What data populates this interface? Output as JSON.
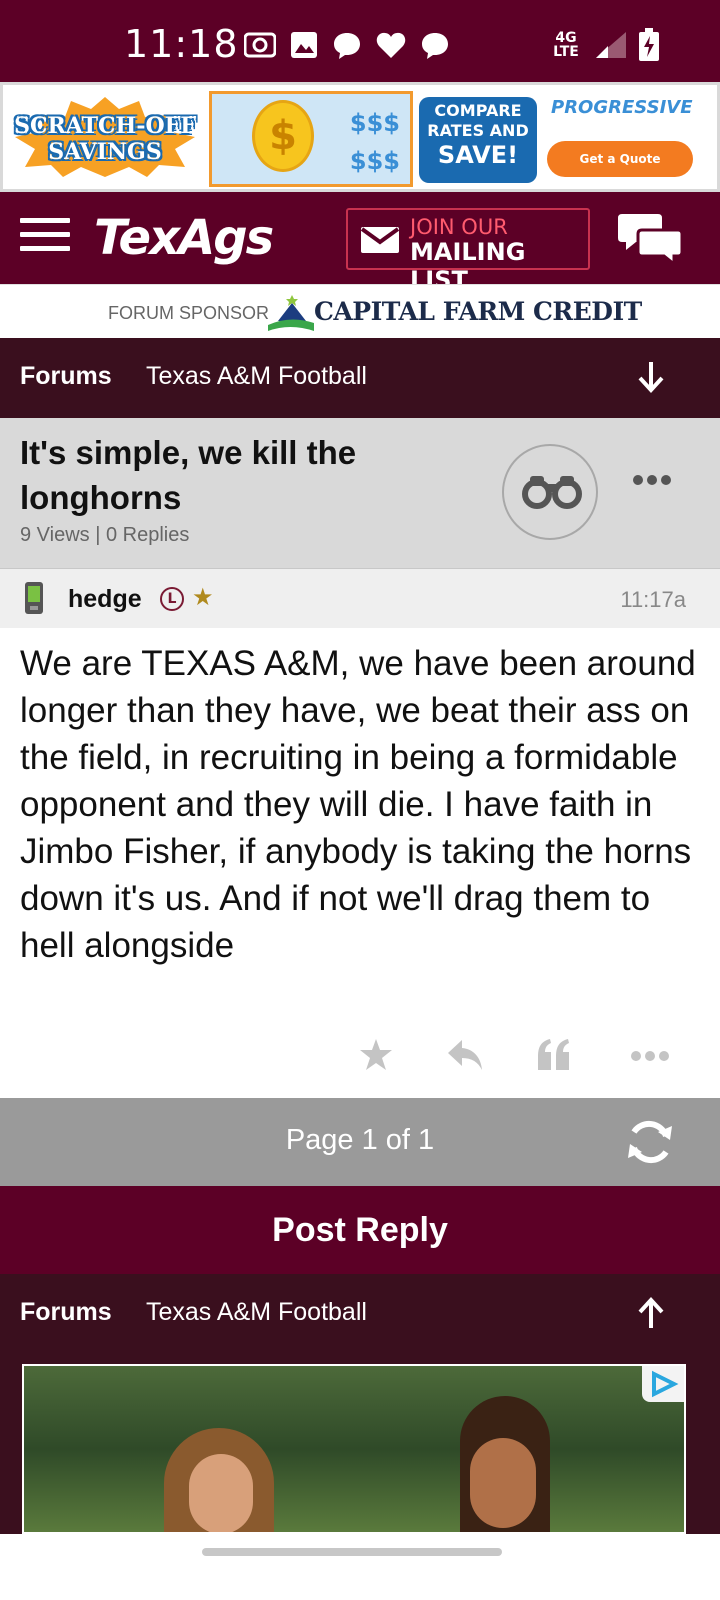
{
  "status_bar": {
    "time": "11:18",
    "network": "4G LTE"
  },
  "ads": {
    "top_banner": {
      "scratch_text": "SCRATCH-OFF SAVINGS",
      "compare_line1": "COMPARE",
      "compare_line2": "RATES AND",
      "compare_line3": "SAVE!",
      "brand": "PROGRESSIVE",
      "cta": "Get a Quote",
      "dollar_row1": "$$$",
      "dollar_row2": "$$$"
    }
  },
  "header": {
    "logo": "TexAgs",
    "mailing_join": "JOIN OUR",
    "mailing_list": "MAILING LIST"
  },
  "sponsor": {
    "label": "FORUM SPONSOR",
    "name": "CAPITAL FARM CREDIT"
  },
  "breadcrumb": {
    "forums": "Forums",
    "board": "Texas A&M Football"
  },
  "thread": {
    "title": "It's simple, we kill the longhorns",
    "stats": "9 Views | 0 Replies"
  },
  "post": {
    "user": "hedge",
    "badge": "L",
    "star": "★",
    "time": "11:17a",
    "body": "We are TEXAS A&M, we have been around longer than they have, we beat their ass on the field, in recruiting in being a formidable opponent and they will die. I have faith in Jimbo Fisher, if anybody is taking the horns down it's us. And if not we'll drag them to hell alongside"
  },
  "pager": {
    "text": "Page 1 of 1"
  },
  "actions": {
    "post_reply": "Post Reply"
  },
  "colors": {
    "maroon": "#5c0026",
    "dark_maroon": "#3a0f1e",
    "gray_bar": "#9a9a9a"
  }
}
